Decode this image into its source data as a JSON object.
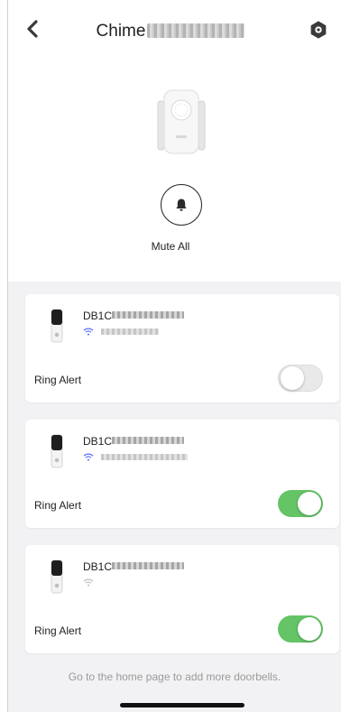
{
  "header": {
    "title": "Chime",
    "back_icon": "chevron-left-icon",
    "settings_icon": "gear-icon"
  },
  "hero": {
    "device_icon": "chime-device-image",
    "mute_icon": "bell-icon",
    "mute_label": "Mute All"
  },
  "doorbells": [
    {
      "name": "DB1C",
      "wifi_icon": "wifi-icon",
      "wifi_color": "#5b6bff",
      "ring_label": "Ring Alert",
      "ring_on": false
    },
    {
      "name": "DB1C",
      "wifi_icon": "wifi-icon",
      "wifi_color": "#5b6bff",
      "ring_label": "Ring Alert",
      "ring_on": true
    },
    {
      "name": "DB1C",
      "wifi_icon": "wifi-icon",
      "wifi_color": "#bdbdbd",
      "ring_label": "Ring Alert",
      "ring_on": true
    }
  ],
  "footer": {
    "note": "Go to the home page to add more doorbells."
  },
  "colors": {
    "toggle_on": "#64c466",
    "toggle_off": "#e9e9ea",
    "section_bg": "#f2f2f4"
  }
}
